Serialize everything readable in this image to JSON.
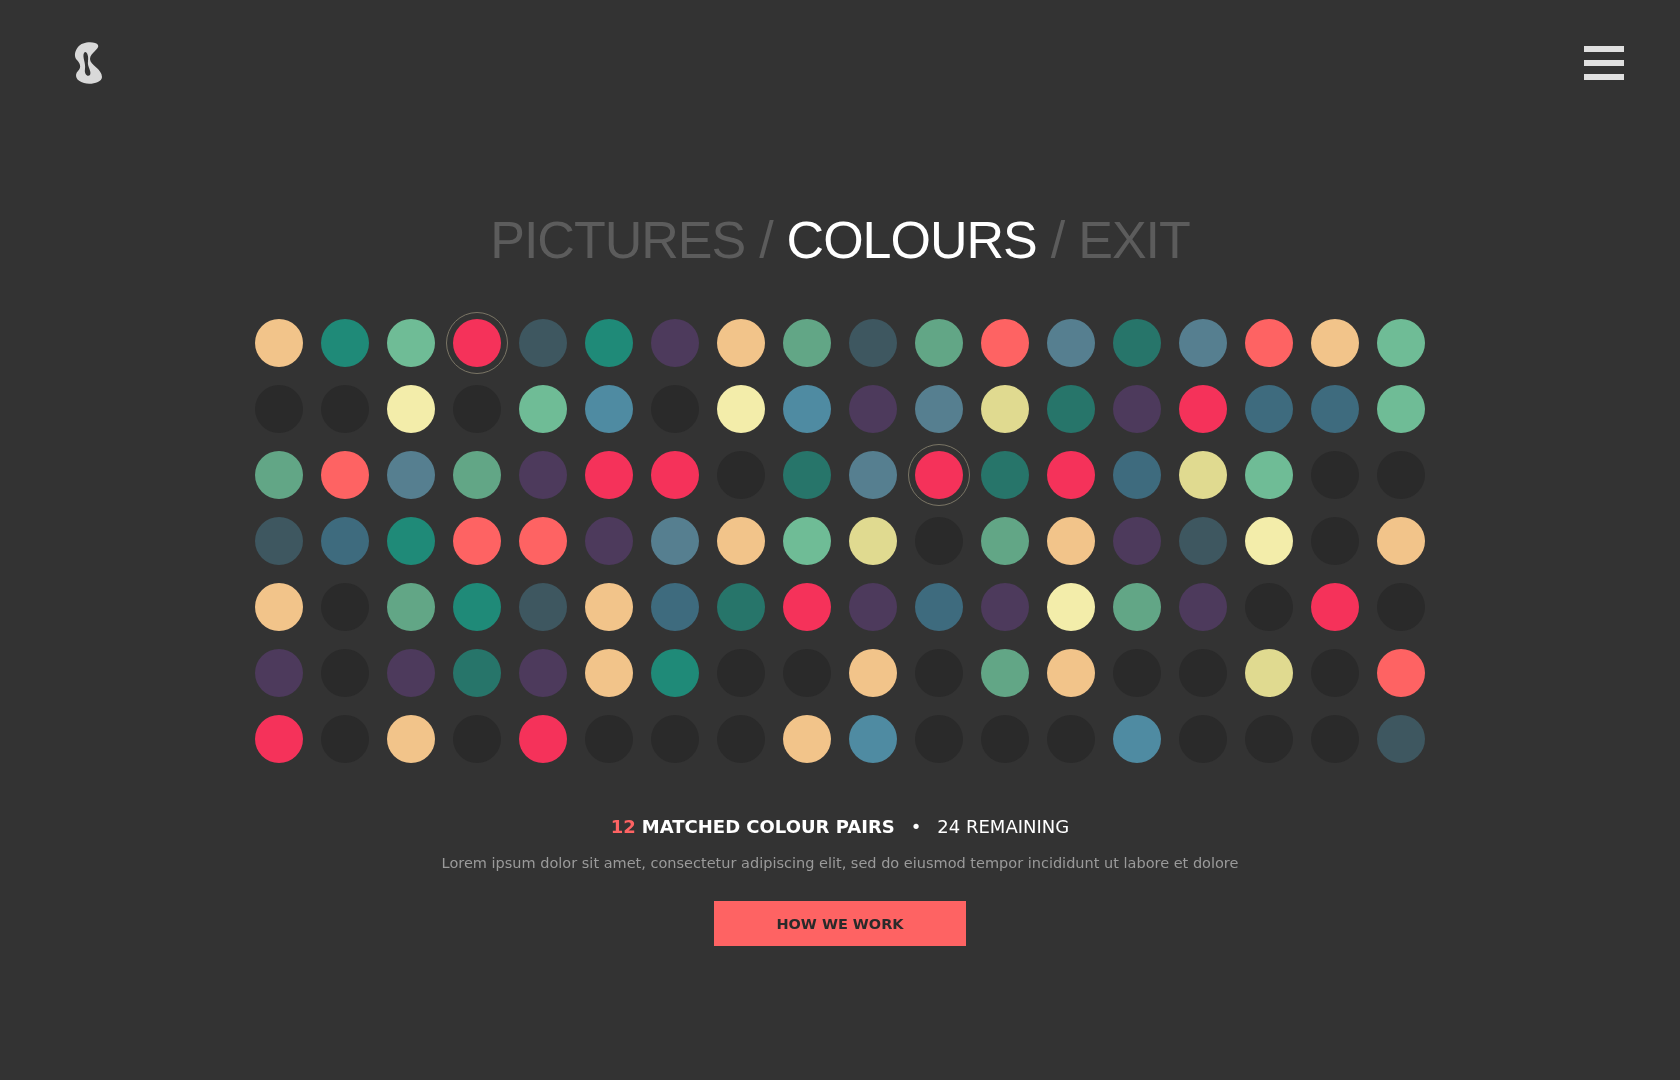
{
  "nav": {
    "items": [
      {
        "label": "PICTURES",
        "selected": false
      },
      {
        "label": "COLOURS",
        "selected": true
      },
      {
        "label": "EXIT",
        "selected": false
      }
    ],
    "separators": [
      "/",
      "/"
    ]
  },
  "rows": [
    [
      {
        "color": "#f2c48a",
        "selected": false
      },
      {
        "color": "#1f8a78",
        "selected": false
      },
      {
        "color": "#6fbc96",
        "selected": false
      },
      {
        "color": "#f5325a",
        "selected": true
      },
      {
        "color": "#3e5760",
        "selected": false
      },
      {
        "color": "#1f8a78",
        "selected": false
      },
      {
        "color": "#4d3a5c",
        "selected": false
      },
      {
        "color": "#f2c48a",
        "selected": false
      },
      {
        "color": "#62a686",
        "selected": false
      },
      {
        "color": "#3e5760",
        "selected": false
      },
      {
        "color": "#62a686",
        "selected": false
      },
      {
        "color": "#fe6363",
        "selected": false
      },
      {
        "color": "#567f90",
        "selected": false
      },
      {
        "color": "#27756a",
        "selected": false
      },
      {
        "color": "#567f90",
        "selected": false
      },
      {
        "color": "#fe6363",
        "selected": false
      },
      {
        "color": "#f2c48a",
        "selected": false
      },
      {
        "color": "#6fbc96",
        "selected": false
      }
    ],
    [
      {
        "color": "#2a2a2a",
        "selected": false
      },
      {
        "color": "#2a2a2a",
        "selected": false
      },
      {
        "color": "#f3edaa",
        "selected": false
      },
      {
        "color": "#2a2a2a",
        "selected": false
      },
      {
        "color": "#6fbc96",
        "selected": false
      },
      {
        "color": "#4f8ba2",
        "selected": false
      },
      {
        "color": "#2a2a2a",
        "selected": false
      },
      {
        "color": "#f3edaa",
        "selected": false
      },
      {
        "color": "#4f8ba2",
        "selected": false
      },
      {
        "color": "#4d3a5c",
        "selected": false
      },
      {
        "color": "#567f90",
        "selected": false
      },
      {
        "color": "#e0da90",
        "selected": false
      },
      {
        "color": "#27756a",
        "selected": false
      },
      {
        "color": "#4d3a5c",
        "selected": false
      },
      {
        "color": "#f5325a",
        "selected": false
      },
      {
        "color": "#3e6b7e",
        "selected": false
      },
      {
        "color": "#3e6b7e",
        "selected": false
      },
      {
        "color": "#6fbc96",
        "selected": false
      }
    ],
    [
      {
        "color": "#62a686",
        "selected": false
      },
      {
        "color": "#fe6363",
        "selected": false
      },
      {
        "color": "#567f90",
        "selected": false
      },
      {
        "color": "#62a686",
        "selected": false
      },
      {
        "color": "#4d3a5c",
        "selected": false
      },
      {
        "color": "#f5325a",
        "selected": false
      },
      {
        "color": "#f5325a",
        "selected": false
      },
      {
        "color": "#2a2a2a",
        "selected": false
      },
      {
        "color": "#27756a",
        "selected": false
      },
      {
        "color": "#567f90",
        "selected": false
      },
      {
        "color": "#f5325a",
        "selected": true
      },
      {
        "color": "#27756a",
        "selected": false
      },
      {
        "color": "#f5325a",
        "selected": false
      },
      {
        "color": "#3e6b7e",
        "selected": false
      },
      {
        "color": "#e0da90",
        "selected": false
      },
      {
        "color": "#6fbc96",
        "selected": false
      },
      {
        "color": "#2a2a2a",
        "selected": false
      },
      {
        "color": "#2a2a2a",
        "selected": false
      }
    ],
    [
      {
        "color": "#3e5760",
        "selected": false
      },
      {
        "color": "#3e6b7e",
        "selected": false
      },
      {
        "color": "#1f8a78",
        "selected": false
      },
      {
        "color": "#fe6363",
        "selected": false
      },
      {
        "color": "#fe6363",
        "selected": false
      },
      {
        "color": "#4d3a5c",
        "selected": false
      },
      {
        "color": "#567f90",
        "selected": false
      },
      {
        "color": "#f2c48a",
        "selected": false
      },
      {
        "color": "#6fbc96",
        "selected": false
      },
      {
        "color": "#e0da90",
        "selected": false
      },
      {
        "color": "#2a2a2a",
        "selected": false
      },
      {
        "color": "#62a686",
        "selected": false
      },
      {
        "color": "#f2c48a",
        "selected": false
      },
      {
        "color": "#4d3a5c",
        "selected": false
      },
      {
        "color": "#3e5760",
        "selected": false
      },
      {
        "color": "#f3edaa",
        "selected": false
      },
      {
        "color": "#2a2a2a",
        "selected": false
      },
      {
        "color": "#f2c48a",
        "selected": false
      }
    ],
    [
      {
        "color": "#f2c48a",
        "selected": false
      },
      {
        "color": "#2a2a2a",
        "selected": false
      },
      {
        "color": "#62a686",
        "selected": false
      },
      {
        "color": "#1f8a78",
        "selected": false
      },
      {
        "color": "#3e5760",
        "selected": false
      },
      {
        "color": "#f2c48a",
        "selected": false
      },
      {
        "color": "#3e6b7e",
        "selected": false
      },
      {
        "color": "#27756a",
        "selected": false
      },
      {
        "color": "#f5325a",
        "selected": false
      },
      {
        "color": "#4d3a5c",
        "selected": false
      },
      {
        "color": "#3e6b7e",
        "selected": false
      },
      {
        "color": "#4d3a5c",
        "selected": false
      },
      {
        "color": "#f3edaa",
        "selected": false
      },
      {
        "color": "#62a686",
        "selected": false
      },
      {
        "color": "#4d3a5c",
        "selected": false
      },
      {
        "color": "#2a2a2a",
        "selected": false
      },
      {
        "color": "#f5325a",
        "selected": false
      },
      {
        "color": "#2a2a2a",
        "selected": false
      }
    ],
    [
      {
        "color": "#4d3a5c",
        "selected": false
      },
      {
        "color": "#2a2a2a",
        "selected": false
      },
      {
        "color": "#4d3a5c",
        "selected": false
      },
      {
        "color": "#27756a",
        "selected": false
      },
      {
        "color": "#4d3a5c",
        "selected": false
      },
      {
        "color": "#f2c48a",
        "selected": false
      },
      {
        "color": "#1f8a78",
        "selected": false
      },
      {
        "color": "#2a2a2a",
        "selected": false
      },
      {
        "color": "#2a2a2a",
        "selected": false
      },
      {
        "color": "#f2c48a",
        "selected": false
      },
      {
        "color": "#2a2a2a",
        "selected": false
      },
      {
        "color": "#62a686",
        "selected": false
      },
      {
        "color": "#f2c48a",
        "selected": false
      },
      {
        "color": "#2a2a2a",
        "selected": false
      },
      {
        "color": "#2a2a2a",
        "selected": false
      },
      {
        "color": "#e0da90",
        "selected": false
      },
      {
        "color": "#2a2a2a",
        "selected": false
      },
      {
        "color": "#fe6363",
        "selected": false
      }
    ],
    [
      {
        "color": "#f5325a",
        "selected": false
      },
      {
        "color": "#2a2a2a",
        "selected": false
      },
      {
        "color": "#f2c48a",
        "selected": false
      },
      {
        "color": "#2a2a2a",
        "selected": false
      },
      {
        "color": "#f5325a",
        "selected": false
      },
      {
        "color": "#2a2a2a",
        "selected": false
      },
      {
        "color": "#2a2a2a",
        "selected": false
      },
      {
        "color": "#2a2a2a",
        "selected": false
      },
      {
        "color": "#f2c48a",
        "selected": false
      },
      {
        "color": "#4f8ba2",
        "selected": false
      },
      {
        "color": "#2a2a2a",
        "selected": false
      },
      {
        "color": "#2a2a2a",
        "selected": false
      },
      {
        "color": "#2a2a2a",
        "selected": false
      },
      {
        "color": "#4f8ba2",
        "selected": false
      },
      {
        "color": "#2a2a2a",
        "selected": false
      },
      {
        "color": "#2a2a2a",
        "selected": false
      },
      {
        "color": "#2a2a2a",
        "selected": false
      },
      {
        "color": "#3e5760",
        "selected": false
      }
    ]
  ],
  "stats": {
    "matched_count": "12",
    "matched_label": "MATCHED COLOUR PAIRS",
    "bullet": "•",
    "remaining": "24 REMAINING"
  },
  "description": "Lorem ipsum dolor sit amet, consectetur adipiscing elit, sed do eiusmod tempor incididunt ut labore et dolore",
  "button": "HOW WE WORK"
}
